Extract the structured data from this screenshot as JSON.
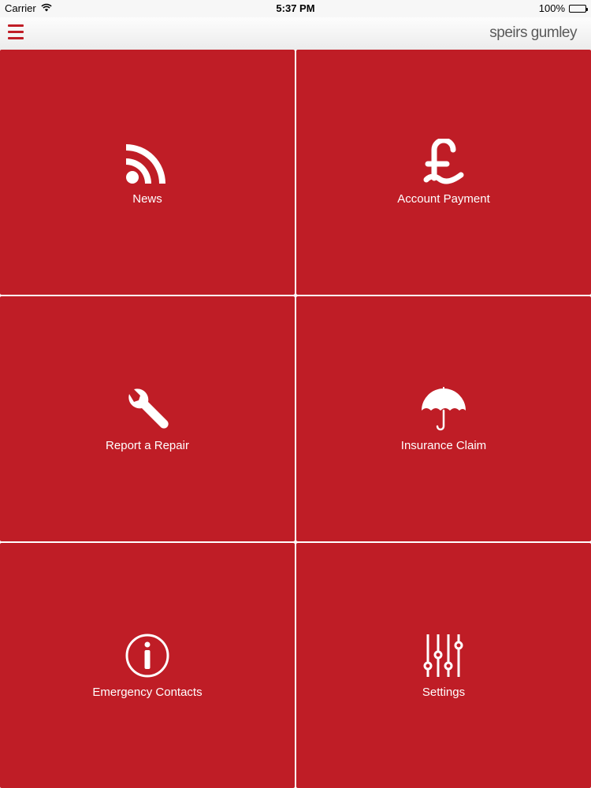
{
  "status_bar": {
    "carrier": "Carrier",
    "time": "5:37 PM",
    "battery": "100%"
  },
  "header": {
    "brand": "speirs gumley",
    "accent_color": "#c01d26"
  },
  "tiles": [
    {
      "label": "News",
      "icon": "rss-icon"
    },
    {
      "label": "Account Payment",
      "icon": "pound-icon"
    },
    {
      "label": "Report a Repair",
      "icon": "wrench-icon"
    },
    {
      "label": "Insurance Claim",
      "icon": "umbrella-icon"
    },
    {
      "label": "Emergency Contacts",
      "icon": "info-icon"
    },
    {
      "label": "Settings",
      "icon": "sliders-icon"
    }
  ],
  "colors": {
    "tile_background": "#bf1d26",
    "tile_text": "#ffffff"
  }
}
